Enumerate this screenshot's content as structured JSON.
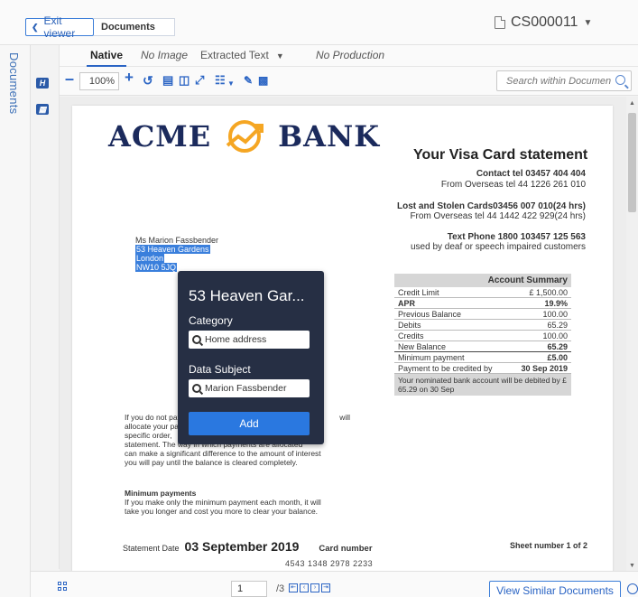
{
  "header": {
    "exit_label": "Exit viewer",
    "doc_tab": "Documents",
    "doc_id": "CS000011"
  },
  "rail": {
    "label": "Documents"
  },
  "tabs": [
    {
      "label": "Native"
    },
    {
      "label": "No Image"
    },
    {
      "label": "Extracted Text"
    },
    {
      "label": "No Production"
    }
  ],
  "toolbar": {
    "zoom": "100%",
    "search_placeholder": "Search within Document"
  },
  "document": {
    "logo_left": "ACME",
    "logo_right": "BANK",
    "title": "Your Visa Card statement",
    "contact_line": "Contact tel 03457 404 404",
    "overseas_line": "From Overseas tel  44 1226 261 010",
    "lost_line": "Lost and Stolen Cards03456 007 010(24 hrs)",
    "lost_overseas": "From Overseas tel  44 1442 422 929(24 hrs)",
    "textphone_line": "Text Phone 1800 103457 125 563",
    "textphone_sub": "used by deaf or speech impaired customers",
    "address": {
      "name": "Ms Marion Fassbender",
      "line1": "53 Heaven Gardens",
      "line2": "London",
      "line3": "NW10 5JQ"
    },
    "summary": {
      "title": "Account Summary",
      "rows": [
        {
          "label": "Credit Limit",
          "value": "£ 1,500.00"
        },
        {
          "label": "APR",
          "value": "19.9%"
        },
        {
          "label": "Previous Balance",
          "value": "100.00"
        },
        {
          "label": "Debits",
          "value": "65.29"
        },
        {
          "label": "Credits",
          "value": "100.00"
        },
        {
          "label": "New Balance",
          "value": "65.29"
        },
        {
          "label": "Minimum payment",
          "value": "£5.00"
        },
        {
          "label": "Payment to be credited by",
          "value": "30 Sep 2019"
        }
      ],
      "footer": "Your nominated bank account will be debited by £ 65.29 on 30 Sep"
    },
    "para1": {
      "line1": "If you do not pay",
      "line1_end": "will",
      "line2": "allocate your pay",
      "line2_end": "a",
      "line3": "specific order,",
      "line4": "statement.  The way in which payments are allocated",
      "line5": "can make a significant difference to the amount of interest",
      "line6": "you will pay until the balance is cleared completely."
    },
    "min_heading": "Minimum payments",
    "min_line1": "If you make only the minimum payment each month, it will",
    "min_line2": "take you longer and cost you more to clear your balance.",
    "statement_date_label": "Statement Date",
    "statement_date": "03 September 2019",
    "card_number_label": "Card number",
    "card_number": "4543 1348 2978 2233",
    "sheet_number": "Sheet number 1 of 2"
  },
  "popover": {
    "title": "53 Heaven Gar...",
    "category_label": "Category",
    "category_value": "Home address",
    "subject_label": "Data Subject",
    "subject_value": "Marion Fassbender",
    "add_label": "Add"
  },
  "pager": {
    "current": "1",
    "total": "/3",
    "view_similar": "View Similar Documents"
  }
}
